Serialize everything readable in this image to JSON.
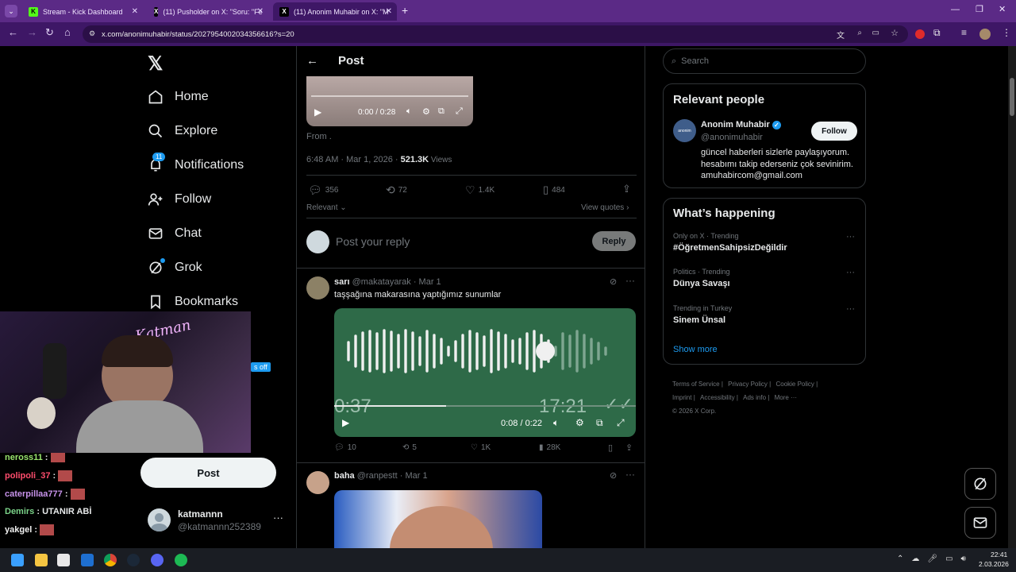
{
  "browser": {
    "tabs": [
      {
        "title": "Stream - Kick Dashboard",
        "active": false
      },
      {
        "title": "(11) Pusholder on X: \"Soru: \"Fe",
        "active": false
      },
      {
        "title": "(11) Anonim Muhabir on X: \"M",
        "active": true
      }
    ],
    "url": "x.com/anonimuhabir/status/2027954002034356616?s=20"
  },
  "leftnav": {
    "items": [
      {
        "label": "Home",
        "icon": "home-icon"
      },
      {
        "label": "Explore",
        "icon": "search-icon"
      },
      {
        "label": "Notifications",
        "icon": "bell-icon",
        "badge": "11"
      },
      {
        "label": "Follow",
        "icon": "add-person-icon"
      },
      {
        "label": "Chat",
        "icon": "mail-icon"
      },
      {
        "label": "Grok",
        "icon": "grok-icon"
      },
      {
        "label": "Bookmarks",
        "icon": "bookmark-icon"
      }
    ],
    "post_button": "Post",
    "account": {
      "name": "katmannn",
      "handle": "@katmannn252389"
    }
  },
  "overlay": {
    "chat": [
      {
        "user": "neross11",
        "text": ":",
        "color": "#9ae66e"
      },
      {
        "user": "polipoli_37",
        "text": ":",
        "color": "#ff4d6d"
      },
      {
        "user": "caterpillaa777",
        "text": ":",
        "color": "#c792ea"
      },
      {
        "user": "Demirs",
        "text": ": UTANIR ABİ",
        "color": "#7bd389"
      },
      {
        "user": "yakgel",
        "text": ":",
        "color": "#f2f2f2"
      }
    ],
    "badge_text": "s off"
  },
  "main": {
    "header_title": "Post",
    "video1": {
      "time": "0:00 / 0:28"
    },
    "from_text": "From .",
    "meta": {
      "time": "6:48 AM · Mar 1, 2026 · ",
      "views": "521.3K",
      "views_label": " Views"
    },
    "actions": {
      "replies": "356",
      "reposts": "72",
      "likes": "1.4K",
      "bookmarks": "484"
    },
    "relevant": "Relevant",
    "view_quotes": "View quotes",
    "reply_placeholder": "Post your reply",
    "reply_button": "Reply",
    "tweet1": {
      "name": "sarı",
      "handle": "@makatayarak · Mar 1",
      "text": "taşşağına makarasına yaptığımız sunumlar",
      "overlay_left": "0:37",
      "overlay_right": "17:21",
      "video_time": "0:08 / 0:22",
      "progress": 0.37,
      "actions": {
        "replies": "10",
        "reposts": "5",
        "likes": "1K",
        "views": "28K"
      }
    },
    "tweet2": {
      "name": "baha",
      "handle": "@ranpestt · Mar 1"
    }
  },
  "right": {
    "search_placeholder": "Search",
    "relevant_title": "Relevant people",
    "person": {
      "name": "Anonim Muhabir",
      "handle": "@anonimuhabir",
      "follow": "Follow",
      "bio": "güncel haberleri sizlerle paylaşıyorum. hesabımı takip ederseniz çok sevinirim. amuhabircom@gmail.com"
    },
    "happening_title": "What’s happening",
    "trends": [
      {
        "context": "Only on X · Trending",
        "title": "#ÖğretmenSahipsizDeğildir"
      },
      {
        "context": "Politics · Trending",
        "title": "Dünya Savaşı"
      },
      {
        "context": "Trending in Turkey",
        "title": "Sinem Ünsal"
      }
    ],
    "show_more": "Show more",
    "footer": [
      "Terms of Service",
      "Privacy Policy",
      "Cookie Policy",
      "Imprint",
      "Accessibility",
      "Ads info",
      "More ···",
      "© 2026 X Corp."
    ]
  },
  "taskbar": {
    "time": "22:41",
    "date": "2.03.2026"
  },
  "colors": {
    "accent": "#1d9bf0",
    "tabbar": "#5b2a86",
    "waveform_bg": "#2e6a48"
  }
}
